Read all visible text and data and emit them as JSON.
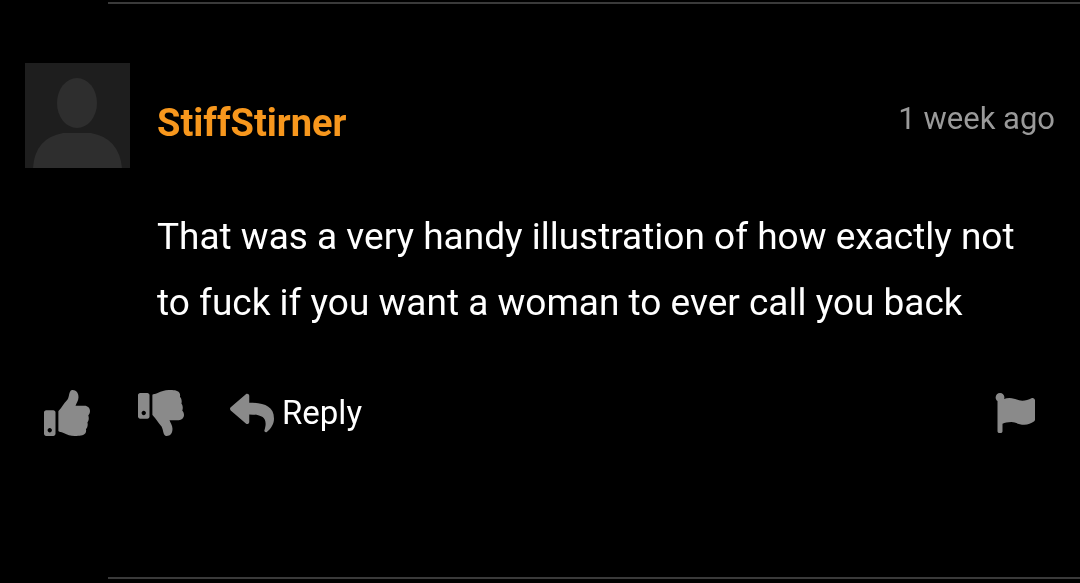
{
  "comment": {
    "username": "StiffStirner",
    "time": "1 week ago",
    "text": "That was a very handy illustration of how exactly not to fuck if you want a woman to ever call you back",
    "reply_label": "Reply"
  }
}
